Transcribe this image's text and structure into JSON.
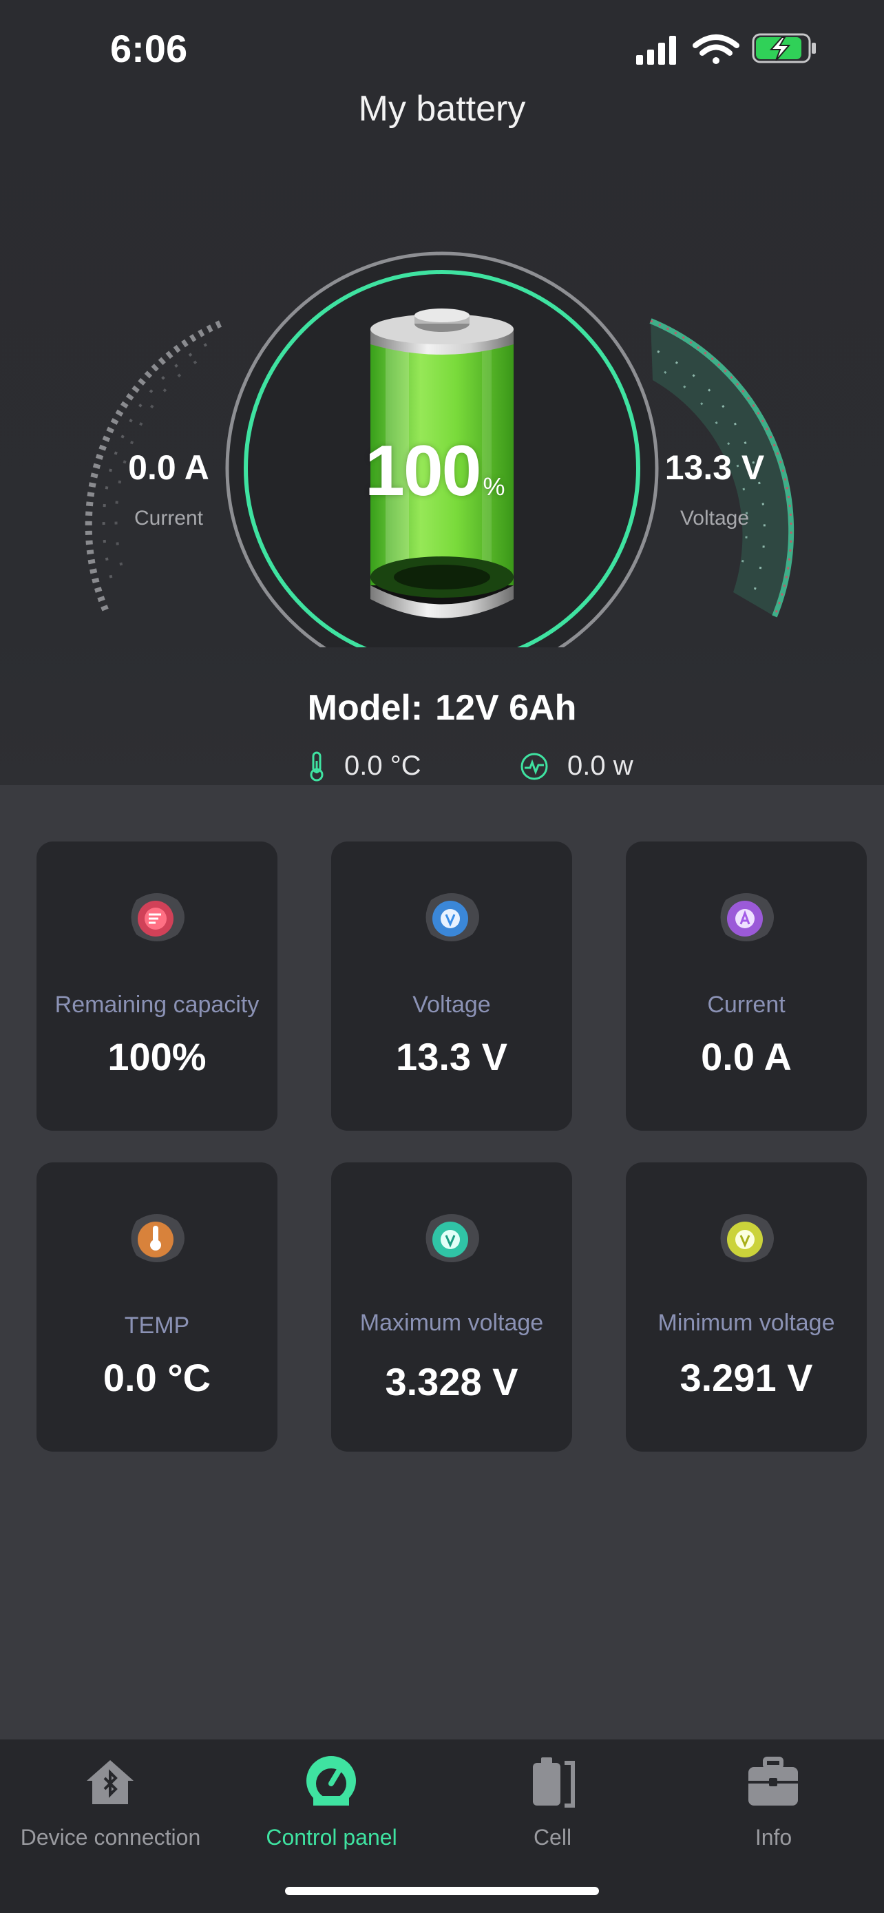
{
  "status_bar": {
    "time": "6:06"
  },
  "header": {
    "title": "My battery"
  },
  "gauge": {
    "current_value": "0.0 A",
    "current_label": "Current",
    "voltage_value": "13.3 V",
    "voltage_label": "Voltage",
    "soc_value": "100",
    "soc_unit": "%",
    "soc_level": 1.0,
    "accent_color": "#3fe3a1"
  },
  "model": {
    "prefix": "Model:",
    "value": "12V 6Ah"
  },
  "mini_stats": {
    "temperature": "0.0 °C",
    "power": "0.0 w"
  },
  "cards": [
    {
      "label": "Remaining capacity",
      "value": "100%",
      "icon": "capacity-icon",
      "color": "#e0405a"
    },
    {
      "label": "Voltage",
      "value": "13.3 V",
      "icon": "voltage-icon",
      "color": "#3a8ee8"
    },
    {
      "label": "Current",
      "value": "0.0 A",
      "icon": "current-icon",
      "color": "#a45ce8"
    },
    {
      "label": "TEMP",
      "value": "0.0 °C",
      "icon": "thermometer-icon",
      "color": "#e8883a"
    },
    {
      "label": "Maximum voltage",
      "value": "3.328 V",
      "icon": "max-voltage-icon",
      "color": "#2ed1b0"
    },
    {
      "label": "Minimum voltage",
      "value": "3.291 V",
      "icon": "min-voltage-icon",
      "color": "#d9e23a"
    }
  ],
  "tabbar": {
    "items": [
      {
        "label": "Device connection",
        "icon": "bluetooth-home-icon",
        "active": false
      },
      {
        "label": "Control panel",
        "icon": "gauge-icon",
        "active": true
      },
      {
        "label": "Cell",
        "icon": "battery-cell-icon",
        "active": false
      },
      {
        "label": "Info",
        "icon": "briefcase-icon",
        "active": false
      }
    ]
  }
}
